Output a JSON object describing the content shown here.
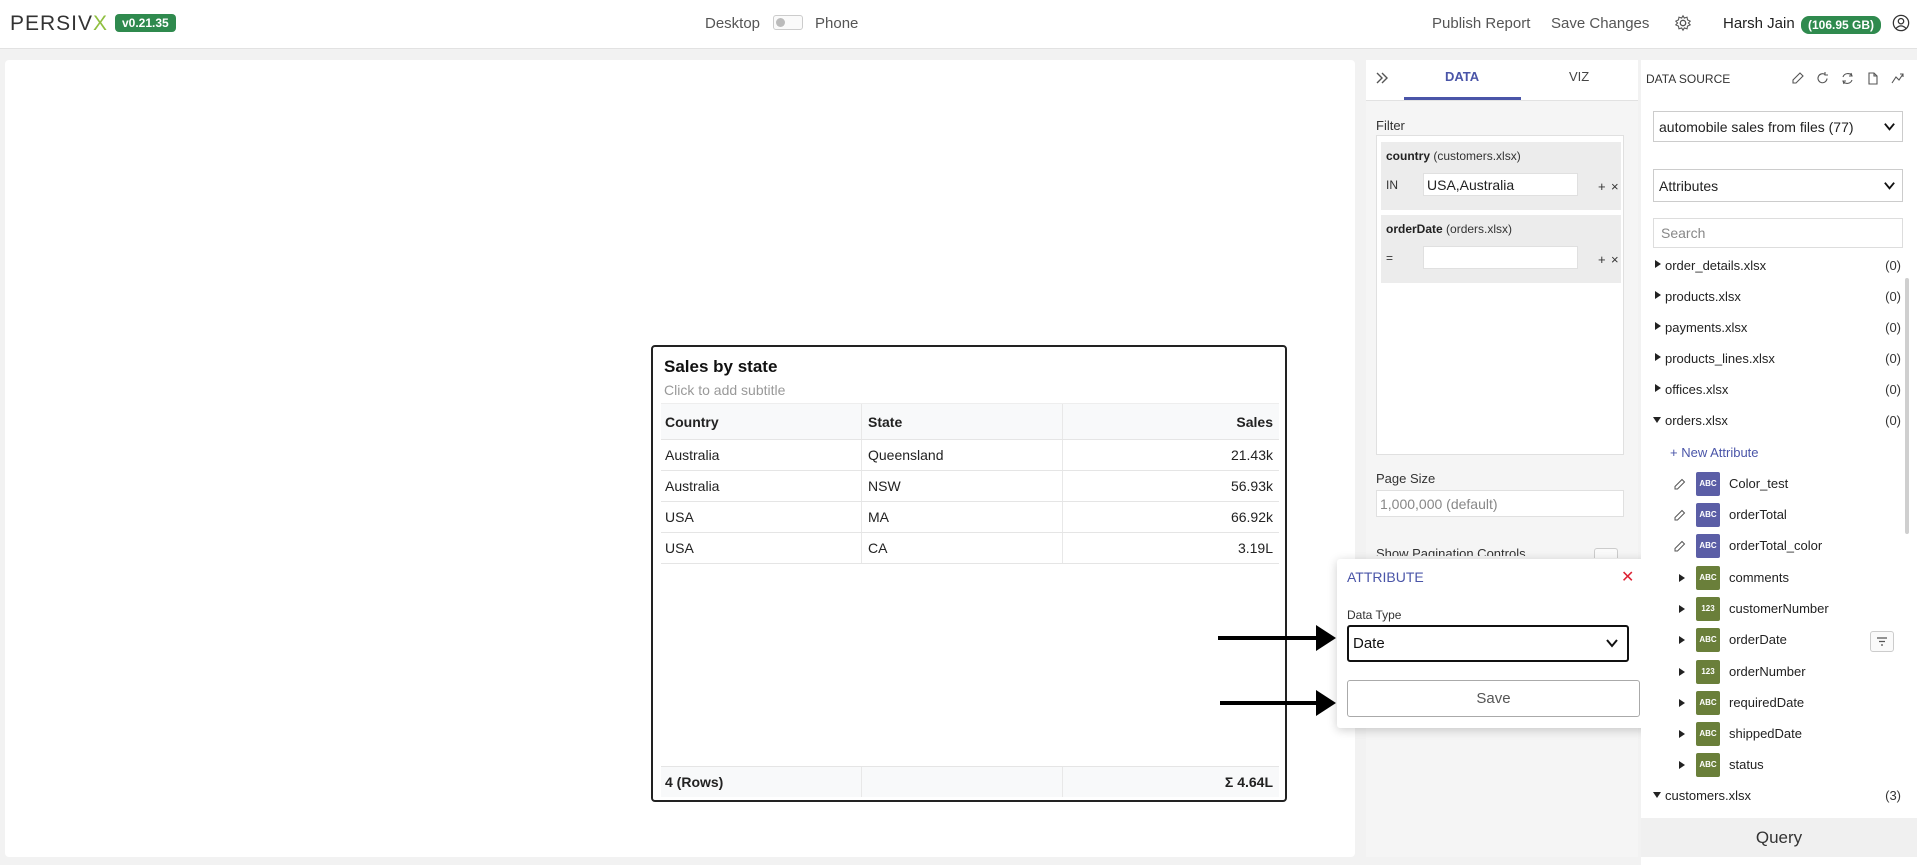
{
  "app": {
    "logo_main": "PERSIV",
    "logo_x": "X",
    "version": "v0.21.35",
    "device_desktop": "Desktop",
    "device_phone": "Phone",
    "publish": "Publish Report",
    "save_changes": "Save Changes",
    "user_name": "Harsh Jain",
    "storage": "(106.95 GB)"
  },
  "widget": {
    "title": "Sales by state",
    "subtitle": "Click to add subtitle",
    "columns": [
      "Country",
      "State",
      "Sales"
    ],
    "rows": [
      [
        "Australia",
        "Queensland",
        "21.43k"
      ],
      [
        "Australia",
        "NSW",
        "56.93k"
      ],
      [
        "USA",
        "MA",
        "66.92k"
      ],
      [
        "USA",
        "CA",
        "3.19L"
      ]
    ],
    "footer_rows": "4 (Rows)",
    "footer_total": "Σ 4.64L"
  },
  "mid": {
    "tab_data": "DATA",
    "tab_viz": "VIZ",
    "filter_label": "Filter",
    "filters": [
      {
        "field": "country",
        "source": "(customers.xlsx)",
        "op": "IN",
        "value": "USA,Australia"
      },
      {
        "field": "orderDate",
        "source": "(orders.xlsx)",
        "op": "=",
        "value": ""
      }
    ],
    "page_size_label": "Page Size",
    "page_size_value": "1,000,000 (default)",
    "pagination_label": "Show Pagination Controls"
  },
  "attribute_popup": {
    "title": "ATTRIBUTE",
    "data_type_label": "Data Type",
    "data_type_value": "Date",
    "save": "Save"
  },
  "right": {
    "title": "DATA SOURCE",
    "source_select": "automobile sales from files (77)",
    "mode_select": "Attributes",
    "search_placeholder": "Search",
    "files": [
      {
        "name": "order_details.xlsx",
        "count": "(0)"
      },
      {
        "name": "products.xlsx",
        "count": "(0)"
      },
      {
        "name": "payments.xlsx",
        "count": "(0)"
      },
      {
        "name": "products_lines.xlsx",
        "count": "(0)"
      },
      {
        "name": "offices.xlsx",
        "count": "(0)"
      },
      {
        "name": "orders.xlsx",
        "count": "(0)"
      }
    ],
    "new_attribute": "+ New Attribute",
    "attributes": [
      {
        "name": "Color_test",
        "type": "ABC"
      },
      {
        "name": "orderTotal",
        "type": "ABC"
      },
      {
        "name": "orderTotal_color",
        "type": "ABC"
      },
      {
        "name": "comments",
        "type": "ABC"
      },
      {
        "name": "customerNumber",
        "type": "123"
      },
      {
        "name": "orderDate",
        "type": "ABC"
      },
      {
        "name": "orderNumber",
        "type": "123"
      },
      {
        "name": "requiredDate",
        "type": "ABC"
      },
      {
        "name": "shippedDate",
        "type": "ABC"
      },
      {
        "name": "status",
        "type": "ABC"
      }
    ],
    "customers_file": {
      "name": "customers.xlsx",
      "count": "(3)"
    },
    "query": "Query"
  },
  "colors": {
    "accent": "#4a55a8",
    "badge_green": "#2f8a4e",
    "calc_attr": "#5b5ea6",
    "field_attr": "#6a7f3a"
  }
}
